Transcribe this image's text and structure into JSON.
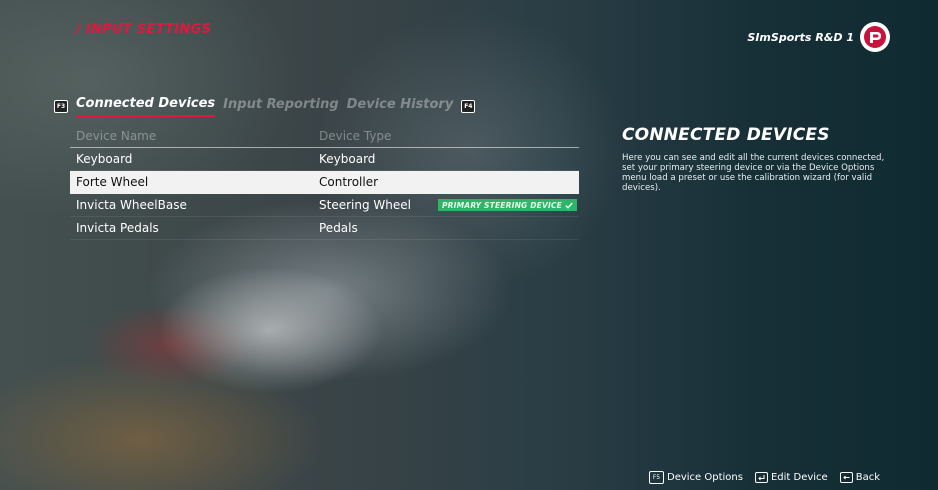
{
  "header": {
    "title": "/ INPUT SETTINGS",
    "profile_name": "SImSports R&D 1"
  },
  "tabs": {
    "left_key": "F3",
    "right_key": "F4",
    "items": [
      {
        "label": "Connected Devices",
        "active": true
      },
      {
        "label": "Input Reporting",
        "active": false
      },
      {
        "label": "Device History",
        "active": false
      }
    ]
  },
  "table": {
    "headers": {
      "name": "Device Name",
      "type": "Device Type"
    },
    "rows": [
      {
        "name": "Keyboard",
        "type": "Keyboard",
        "badge": ""
      },
      {
        "name": "Forte Wheel",
        "type": "Controller",
        "badge": "",
        "selected": true
      },
      {
        "name": "Invicta WheelBase",
        "type": "Steering Wheel",
        "badge": "PRIMARY STEERING DEVICE"
      },
      {
        "name": "Invicta Pedals",
        "type": "Pedals",
        "badge": ""
      }
    ]
  },
  "info": {
    "title": "CONNECTED DEVICES",
    "description": "Here you can see and edit all the current devices connected, set your primary steering device or via the Device Options menu load a preset or use the calibration wizard (for valid devices)."
  },
  "footer": {
    "device_options_key": "F5",
    "device_options_label": "Device Options",
    "edit_device_label": "Edit Device",
    "back_label": "Back"
  },
  "colors": {
    "accent": "#e3173e",
    "primary_badge": "#2fb56a",
    "selected_row": "#f2f2f2"
  }
}
